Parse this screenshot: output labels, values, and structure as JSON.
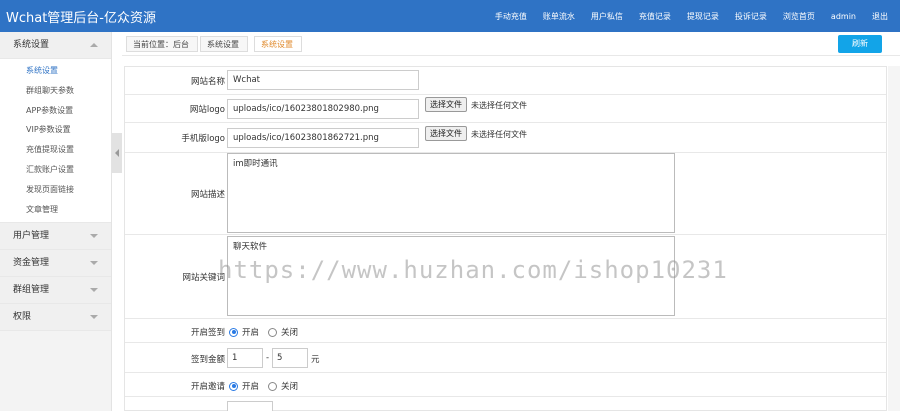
{
  "header": {
    "brand": "Wchat管理后台-亿众资源",
    "nav": [
      "手动充值",
      "账单流水",
      "用户私信",
      "充值记录",
      "提现记录",
      "投诉记录",
      "浏览首页",
      "admin",
      "退出"
    ]
  },
  "sidebar": {
    "groups": [
      {
        "label": "系统设置",
        "expanded": true,
        "items": [
          "系统设置",
          "群组聊天参数",
          "APP参数设置",
          "VIP参数设置",
          "充值提现设置",
          "汇款账户设置",
          "发现页面链接",
          "文章管理"
        ],
        "active_item": "系统设置"
      },
      {
        "label": "用户管理",
        "expanded": false
      },
      {
        "label": "资金管理",
        "expanded": false
      },
      {
        "label": "群组管理",
        "expanded": false
      },
      {
        "label": "权限",
        "expanded": false
      }
    ]
  },
  "breadcrumb": {
    "items": [
      "当前位置：后台",
      "系统设置",
      "系统设置"
    ]
  },
  "refresh_label": "刷新",
  "form": {
    "site_name": {
      "label": "网站名称",
      "value": "Wchat"
    },
    "site_logo": {
      "label": "网站logo",
      "value": "uploads/ico/16023801802980.png",
      "button": "选择文件",
      "note": "未选择任何文件"
    },
    "mobile_logo": {
      "label": "手机版logo",
      "value": "uploads/ico/16023801862721.png",
      "button": "选择文件",
      "note": "未选择任何文件"
    },
    "site_desc": {
      "label": "网站描述",
      "value": "im即时通讯"
    },
    "site_keywords": {
      "label": "网站关键词",
      "value": "聊天软件"
    },
    "checkin": {
      "label": "开启签到",
      "on": "开启",
      "off": "关闭",
      "selected": "开启"
    },
    "checkin_amount": {
      "label": "签到金额",
      "min": "1",
      "sep": "-",
      "max": "5",
      "unit": "元"
    },
    "invite": {
      "label": "开启邀请",
      "on": "开启",
      "off": "关闭",
      "selected": "开启"
    }
  },
  "watermark": "https://www.huzhan.com/ishop10231",
  "colors": {
    "header": "#2f73c5",
    "refresh": "#12a4e8",
    "active_crumb": "#e08a2c",
    "radio": "#2a7ae4"
  }
}
